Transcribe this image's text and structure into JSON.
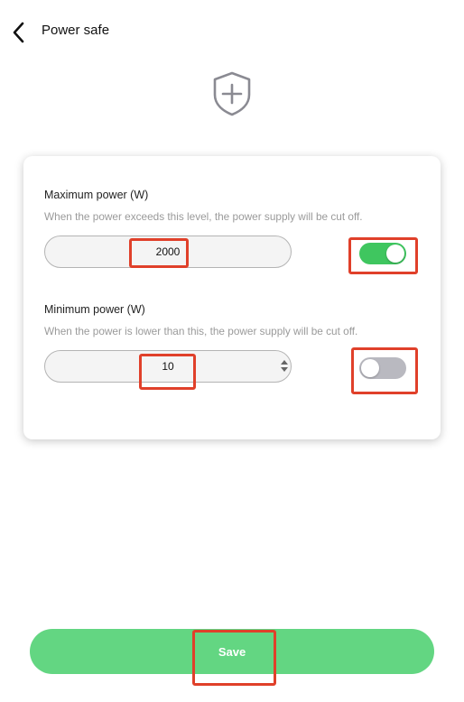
{
  "header": {
    "title": "Power safe",
    "back_icon": "chevron-left-icon"
  },
  "shield_icon": "shield-plus-icon",
  "maximum_power": {
    "title": "Maximum power (W)",
    "description": "When the power exceeds this level, the power supply will be cut off.",
    "value": "2000",
    "enabled": true
  },
  "minimum_power": {
    "title": "Minimum power (W)",
    "description": "When the power is lower than this, the power supply will be cut off.",
    "value": "10",
    "enabled": false
  },
  "save_label": "Save",
  "colors": {
    "accent_green": "#63d682",
    "toggle_on": "#3fc65f",
    "toggle_off": "#b9b9c0",
    "annotation_red": "#e0402a"
  }
}
